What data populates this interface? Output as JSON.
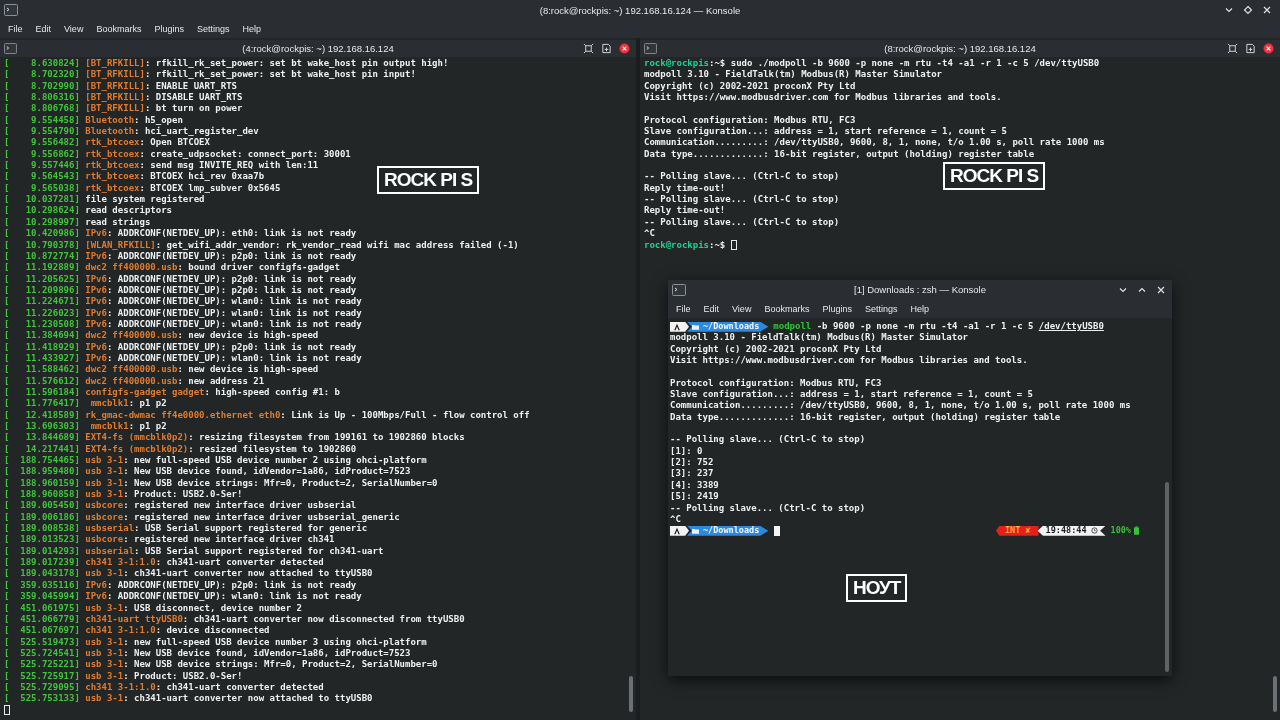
{
  "window": {
    "title": "(8:rock@rockpis: ~) 192.168.16.124 — Konsole"
  },
  "menu": [
    "File",
    "Edit",
    "View",
    "Bookmarks",
    "Plugins",
    "Settings",
    "Help"
  ],
  "left_pane": {
    "title": "(4:rock@rockpis: ~) 192.168.16.124",
    "lines": [
      {
        "time": "[    8.630824]",
        "source": "[BT_RFKILL]",
        "message": ": rfkill_rk_set_power: set bt wake_host pin output high!"
      },
      {
        "time": "[    8.702320]",
        "source": "[BT_RFKILL]",
        "message": ": rfkill_rk_set_power: set bt wake_host pin input!"
      },
      {
        "time": "[    8.702990]",
        "source": "[BT_RFKILL]",
        "message": ": ENABLE UART_RTS"
      },
      {
        "time": "[    8.806316]",
        "source": "[BT_RFKILL]",
        "message": ": DISABLE UART_RTS"
      },
      {
        "time": "[    8.806768]",
        "source": "[BT_RFKILL]",
        "message": ": bt turn on power"
      },
      {
        "time": "[    9.554458]",
        "source": "Bluetooth",
        "message": ": h5_open"
      },
      {
        "time": "[    9.554790]",
        "source": "Bluetooth",
        "message": ": hci_uart_register_dev"
      },
      {
        "time": "[    9.556482]",
        "source": "rtk_btcoex",
        "message": ": Open BTCOEX"
      },
      {
        "time": "[    9.556862]",
        "source": "rtk_btcoex",
        "message": ": create_udpsocket: connect_port: 30001"
      },
      {
        "time": "[    9.557446]",
        "source": "rtk_btcoex",
        "message": ": send msg INVITE_REQ with len:11"
      },
      {
        "time": "[    9.564543]",
        "source": "rtk_btcoex",
        "message": ": BTCOEX hci_rev 0xaa7b"
      },
      {
        "time": "[    9.565038]",
        "source": "rtk_btcoex",
        "message": ": BTCOEX lmp_subver 0x5645"
      },
      {
        "time": "[   10.037281]",
        "message": "file system registered"
      },
      {
        "time": "[   10.298624]",
        "message": "read descriptors"
      },
      {
        "time": "[   10.298997]",
        "message": "read strings"
      },
      {
        "time": "[   10.420986]",
        "source": "IPv6",
        "message": ": ADDRCONF(NETDEV_UP): eth0: link is not ready"
      },
      {
        "time": "[   10.790378]",
        "source": "[WLAN_RFKILL]",
        "message": ": get_wifi_addr_vendor: rk_vendor_read wifi mac address failed (-1)"
      },
      {
        "time": "[   10.872774]",
        "source": "IPv6",
        "message": ": ADDRCONF(NETDEV_UP): p2p0: link is not ready"
      },
      {
        "time": "[   11.192889]",
        "source": "dwc2 ff400000.usb",
        "message": ": bound driver configfs-gadget"
      },
      {
        "time": "[   11.205625]",
        "source": "IPv6",
        "message": ": ADDRCONF(NETDEV_UP): p2p0: link is not ready"
      },
      {
        "time": "[   11.209896]",
        "source": "IPv6",
        "message": ": ADDRCONF(NETDEV_UP): p2p0: link is not ready"
      },
      {
        "time": "[   11.224671]",
        "source": "IPv6",
        "message": ": ADDRCONF(NETDEV_UP): wlan0: link is not ready"
      },
      {
        "time": "[   11.226023]",
        "source": "IPv6",
        "message": ": ADDRCONF(NETDEV_UP): wlan0: link is not ready"
      },
      {
        "time": "[   11.230508]",
        "source": "IPv6",
        "message": ": ADDRCONF(NETDEV_UP): wlan0: link is not ready"
      },
      {
        "time": "[   11.384694]",
        "source": "dwc2 ff400000.usb",
        "message": ": new device is high-speed"
      },
      {
        "time": "[   11.418929]",
        "source": "IPv6",
        "message": ": ADDRCONF(NETDEV_UP): p2p0: link is not ready"
      },
      {
        "time": "[   11.433927]",
        "source": "IPv6",
        "message": ": ADDRCONF(NETDEV_UP): wlan0: link is not ready"
      },
      {
        "time": "[   11.588462]",
        "source": "dwc2 ff400000.usb",
        "message": ": new device is high-speed"
      },
      {
        "time": "[   11.576612]",
        "source": "dwc2 ff400000.usb",
        "message": ": new address 21"
      },
      {
        "time": "[   11.596184]",
        "source": "configfs-gadget gadget",
        "message": ": high-speed config #1: b"
      },
      {
        "time": "[   11.776417]",
        "source": " mmcblk1",
        "message": ": p1 p2"
      },
      {
        "time": "[   12.418589]",
        "source": "rk_gmac-dwmac ff4e0000.ethernet eth0",
        "message": ": Link is Up - 100Mbps/Full - flow control off"
      },
      {
        "time": "[   13.696303]",
        "source": " mmcblk1",
        "message": ": p1 p2"
      },
      {
        "time": "[   13.844689]",
        "source": "EXT4-fs (mmcblk0p2)",
        "message": ": resizing filesystem from 199161 to 1902860 blocks"
      },
      {
        "time": "[   14.217441]",
        "source": "EXT4-fs (mmcblk0p2)",
        "message": ": resized filesystem to 1902860"
      },
      {
        "time": "[  188.754465]",
        "source": "usb 3-1",
        "message": ": new full-speed USB device number 2 using ohci-platform"
      },
      {
        "time": "[  188.959480]",
        "source": "usb 3-1",
        "message": ": New USB device found, idVendor=1a86, idProduct=7523"
      },
      {
        "time": "[  188.960159]",
        "source": "usb 3-1",
        "message": ": New USB device strings: Mfr=0, Product=2, SerialNumber=0"
      },
      {
        "time": "[  188.960858]",
        "source": "usb 3-1",
        "message": ": Product: USB2.0-Ser!"
      },
      {
        "time": "[  189.005450]",
        "source": "usbcore",
        "message": ": registered new interface driver usbserial"
      },
      {
        "time": "[  189.006186]",
        "source": "usbcore",
        "message": ": registered new interface driver usbserial_generic"
      },
      {
        "time": "[  189.008538]",
        "source": "usbserial",
        "message": ": USB Serial support registered for generic"
      },
      {
        "time": "[  189.013523]",
        "source": "usbcore",
        "message": ": registered new interface driver ch341"
      },
      {
        "time": "[  189.014293]",
        "source": "usbserial",
        "message": ": USB Serial support registered for ch341-uart"
      },
      {
        "time": "[  189.017239]",
        "source": "ch341 3-1:1.0",
        "message": ": ch341-uart converter detected"
      },
      {
        "time": "[  189.043178]",
        "source": "usb 3-1",
        "message": ": ch341-uart converter now attached to ttyUSB0"
      },
      {
        "time": "[  359.035116]",
        "source": "IPv6",
        "message": ": ADDRCONF(NETDEV_UP): p2p0: link is not ready"
      },
      {
        "time": "[  359.045994]",
        "source": "IPv6",
        "message": ": ADDRCONF(NETDEV_UP): wlan0: link is not ready"
      },
      {
        "time": "[  451.061975]",
        "source": "usb 3-1",
        "message": ": USB disconnect, device number 2"
      },
      {
        "time": "[  451.066779]",
        "source": "ch341-uart ttyUSB0",
        "message": ": ch341-uart converter now disconnected from ttyUSB0"
      },
      {
        "time": "[  451.067697]",
        "source": "ch341 3-1:1.0",
        "message": ": device disconnected"
      },
      {
        "time": "[  525.519473]",
        "source": "usb 3-1",
        "message": ": new full-speed USB device number 3 using ohci-platform"
      },
      {
        "time": "[  525.724541]",
        "source": "usb 3-1",
        "message": ": New USB device found, idVendor=1a86, idProduct=7523"
      },
      {
        "time": "[  525.725221]",
        "source": "usb 3-1",
        "message": ": New USB device strings: Mfr=0, Product=2, SerialNumber=0"
      },
      {
        "time": "[  525.725917]",
        "source": "usb 3-1",
        "message": ": Product: USB2.0-Ser!"
      },
      {
        "time": "[  525.729095]",
        "source": "ch341 3-1:1.0",
        "message": ": ch341-uart converter detected"
      },
      {
        "time": "[  525.753133]",
        "source": "usb 3-1",
        "message": ": ch341-uart converter now attached to ttyUSB0"
      }
    ]
  },
  "right_pane": {
    "title": "(8:rock@rockpis: ~) 192.168.16.124",
    "lines": [
      {
        "kind": "prompt",
        "user": "rock@rockpis",
        "path": ":~$",
        "command": "sudo ./modpoll -b 9600 -p none -m rtu -t4 -a1 -r 1 -c 5 /dev/ttyUSB0",
        "cursor": false
      },
      {
        "kind": "text",
        "text": "modpoll 3.10 - FieldTalk(tm) Modbus(R) Master Simulator"
      },
      {
        "kind": "text",
        "text": "Copyright (c) 2002-2021 proconX Pty Ltd"
      },
      {
        "kind": "text",
        "text": "Visit https://www.modbusdriver.com for Modbus libraries and tools."
      },
      {
        "kind": "blank"
      },
      {
        "kind": "text",
        "text": "Protocol configuration: Modbus RTU, FC3"
      },
      {
        "kind": "text",
        "text": "Slave configuration...: address = 1, start reference = 1, count = 5"
      },
      {
        "kind": "text",
        "text": "Communication.........: /dev/ttyUSB0, 9600, 8, 1, none, t/o 1.00 s, poll rate 1000 ms"
      },
      {
        "kind": "text",
        "text": "Data type.............: 16-bit register, output (holding) register table"
      },
      {
        "kind": "blank"
      },
      {
        "kind": "text",
        "text": "-- Polling slave... (Ctrl-C to stop)"
      },
      {
        "kind": "text",
        "text": "Reply time-out!"
      },
      {
        "kind": "text",
        "text": "-- Polling slave... (Ctrl-C to stop)"
      },
      {
        "kind": "text",
        "text": "Reply time-out!"
      },
      {
        "kind": "text",
        "text": "-- Polling slave... (Ctrl-C to stop)"
      },
      {
        "kind": "text",
        "text": "^C"
      },
      {
        "kind": "prompt",
        "user": "rock@rockpis",
        "path": ":~$",
        "cursor": true
      }
    ]
  },
  "inner_window": {
    "title": "[1] Downloads : zsh — Konsole",
    "menu": [
      "File",
      "Edit",
      "View",
      "Bookmarks",
      "Plugins",
      "Settings",
      "Help"
    ],
    "lines": [
      {
        "kind": "prompt",
        "directory": "~/Downloads",
        "program": "modpoll",
        "arguments": " -b 9600 -p none -m rtu -t4 -a1 -r 1 -c 5 ",
        "path_argument": "/dev/ttyUSB0",
        "cursor": false
      },
      {
        "kind": "text",
        "text": "modpoll 3.10 - FieldTalk(tm) Modbus(R) Master Simulator"
      },
      {
        "kind": "text",
        "text": "Copyright (c) 2002-2021 proconX Pty Ltd"
      },
      {
        "kind": "text",
        "text": "Visit https://www.modbusdriver.com for Modbus libraries and tools."
      },
      {
        "kind": "blank"
      },
      {
        "kind": "text",
        "text": "Protocol configuration: Modbus RTU, FC3"
      },
      {
        "kind": "text",
        "text": "Slave configuration...: address = 1, start reference = 1, count = 5"
      },
      {
        "kind": "text",
        "text": "Communication.........: /dev/ttyUSB0, 9600, 8, 1, none, t/o 1.00 s, poll rate 1000 ms"
      },
      {
        "kind": "text",
        "text": "Data type.............: 16-bit register, output (holding) register table"
      },
      {
        "kind": "blank"
      },
      {
        "kind": "text",
        "text": "-- Polling slave... (Ctrl-C to stop)"
      },
      {
        "kind": "text",
        "text": "[1]: 0"
      },
      {
        "kind": "text",
        "text": "[2]: 752"
      },
      {
        "kind": "text",
        "text": "[3]: 237"
      },
      {
        "kind": "text",
        "text": "[4]: 3389"
      },
      {
        "kind": "text",
        "text": "[5]: 2419"
      },
      {
        "kind": "text",
        "text": "-- Polling slave... (Ctrl-C to stop)"
      },
      {
        "kind": "text",
        "text": "^C"
      },
      {
        "kind": "prompt",
        "directory": "~/Downloads",
        "cursor": true,
        "status": {
          "exit": "INT ✘",
          "time": "19:48:44",
          "battery": "100%"
        }
      }
    ]
  },
  "annotations": [
    {
      "text": "ROCK PI S"
    },
    {
      "text": "ROCK PI S"
    },
    {
      "text": "НОУТ"
    }
  ]
}
